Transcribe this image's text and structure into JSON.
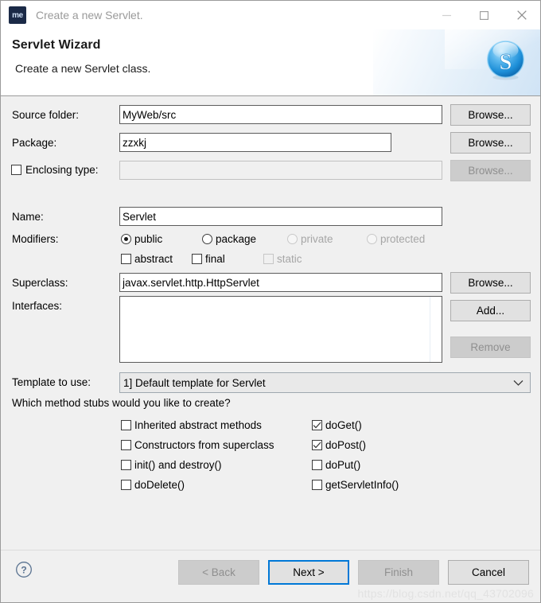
{
  "window": {
    "title": "Create a new Servlet.",
    "app_icon_text": "me",
    "controls": {
      "minimize": "minimize-icon",
      "maximize": "maximize-icon",
      "close": "close-icon"
    }
  },
  "header": {
    "title": "Servlet Wizard",
    "subtitle": "Create a new Servlet class.",
    "logo": "skype-s-logo"
  },
  "form": {
    "source_folder": {
      "label": "Source folder:",
      "value": "MyWeb/src",
      "browse": "Browse..."
    },
    "package": {
      "label": "Package:",
      "value": "zzxkj",
      "browse": "Browse..."
    },
    "enclosing_type": {
      "label": "Enclosing type:",
      "checked": false,
      "value": "",
      "browse": "Browse...",
      "disabled": true
    },
    "name": {
      "label": "Name:",
      "value": "Servlet"
    },
    "modifiers": {
      "label": "Modifiers:",
      "access": [
        {
          "label": "public",
          "selected": true,
          "disabled": false
        },
        {
          "label": "package",
          "selected": false,
          "disabled": false
        },
        {
          "label": "private",
          "selected": false,
          "disabled": true
        },
        {
          "label": "protected",
          "selected": false,
          "disabled": true
        }
      ],
      "flags": [
        {
          "label": "abstract",
          "checked": false,
          "disabled": false
        },
        {
          "label": "final",
          "checked": false,
          "disabled": false
        },
        {
          "label": "static",
          "checked": false,
          "disabled": true
        }
      ]
    },
    "superclass": {
      "label": "Superclass:",
      "value": "javax.servlet.http.HttpServlet",
      "browse": "Browse..."
    },
    "interfaces": {
      "label": "Interfaces:",
      "items": [],
      "add": "Add...",
      "remove": "Remove",
      "remove_disabled": true
    },
    "template": {
      "label": "Template to use:",
      "selected": "1] Default template for Servlet"
    },
    "stubs": {
      "question": "Which method stubs would you like to create?",
      "left_column": [
        {
          "label": "Inherited abstract methods",
          "checked": false
        },
        {
          "label": "Constructors from superclass",
          "checked": false
        },
        {
          "label": "init() and destroy()",
          "checked": false
        },
        {
          "label": "doDelete()",
          "checked": false
        }
      ],
      "right_column": [
        {
          "label": "doGet()",
          "checked": true
        },
        {
          "label": "doPost()",
          "checked": true
        },
        {
          "label": "doPut()",
          "checked": false
        },
        {
          "label": "getServletInfo()",
          "checked": false
        }
      ]
    }
  },
  "footer": {
    "help": "help-icon",
    "back": {
      "label": "< Back",
      "disabled": true,
      "focused": false
    },
    "next": {
      "label": "Next >",
      "disabled": false,
      "focused": true
    },
    "finish": {
      "label": "Finish",
      "disabled": true,
      "focused": false
    },
    "cancel": {
      "label": "Cancel",
      "disabled": false,
      "focused": false
    }
  },
  "watermark": "https://blog.csdn.net/qq_43702096",
  "colors": {
    "accent": "#0078d7",
    "window_bg": "#f0f0f0",
    "header_bg": "#ffffff",
    "field_border": "#5c5c5c",
    "disabled_text": "#a6a6a6"
  }
}
